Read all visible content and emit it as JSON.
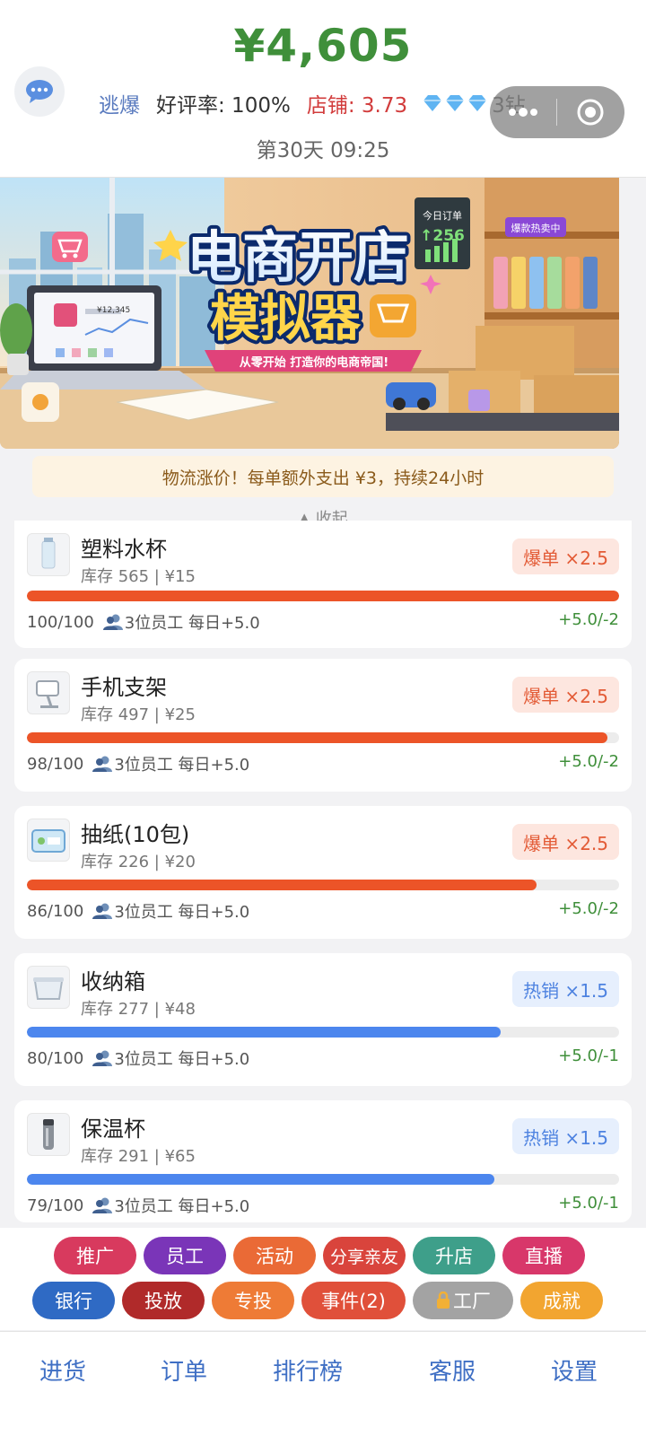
{
  "header": {
    "money": "¥4,605",
    "title_badge": "逃爆",
    "praise_rate": "好评率: 100%",
    "shop_rating": "店铺: 3.73",
    "diamonds": "3钻",
    "day_time": "第30天 09:25"
  },
  "banner": {
    "title_line1": "电商开店",
    "title_line2": "模拟器",
    "slogan": "从零开始 打造你的电商帝国!",
    "order_label": "今日订单",
    "order_value": "↑256",
    "hot_label": "爆款热卖中",
    "price_tag": "¥12,345"
  },
  "notice": "物流涨价！每单额外支出 ¥3，持续24小时",
  "collapse_label": "▲ 收起",
  "products": [
    {
      "name": "塑料水杯",
      "stock": "库存 565 | ¥15",
      "tag": "爆单 ×2.5",
      "tag_type": "hot",
      "progress": 100,
      "progress_text": "100/100",
      "staff": "3位员工 每日+5.0",
      "rate": "+5.0/-2"
    },
    {
      "name": "手机支架",
      "stock": "库存 497 | ¥25",
      "tag": "爆单 ×2.5",
      "tag_type": "hot",
      "progress": 98,
      "progress_text": "98/100",
      "staff": "3位员工 每日+5.0",
      "rate": "+5.0/-2"
    },
    {
      "name": "抽纸(10包)",
      "stock": "库存 226 | ¥20",
      "tag": "爆单 ×2.5",
      "tag_type": "hot",
      "progress": 86,
      "progress_text": "86/100",
      "staff": "3位员工 每日+5.0",
      "rate": "+5.0/-2"
    },
    {
      "name": "收纳箱",
      "stock": "库存 277 | ¥48",
      "tag": "热销 ×1.5",
      "tag_type": "warm",
      "progress": 80,
      "progress_text": "80/100",
      "staff": "3位员工 每日+5.0",
      "rate": "+5.0/-1"
    },
    {
      "name": "保温杯",
      "stock": "库存 291 | ¥65",
      "tag": "热销 ×1.5",
      "tag_type": "warm",
      "progress": 79,
      "progress_text": "79/100",
      "staff": "3位员工 每日+5.0",
      "rate": "+5.0/-1"
    }
  ],
  "actions": [
    {
      "label": "推广",
      "color": "#d83a5e"
    },
    {
      "label": "员工",
      "color": "#7a35b8"
    },
    {
      "label": "活动",
      "color": "#ea6a36"
    },
    {
      "label": "分享亲友",
      "color": "#d9443c"
    },
    {
      "label": "升店",
      "color": "#3e9f8a"
    },
    {
      "label": "直播",
      "color": "#d8376a"
    },
    {
      "label": "银行",
      "color": "#2f6ac4"
    },
    {
      "label": "投放",
      "color": "#b02a2a"
    },
    {
      "label": "专投",
      "color": "#ee7b36"
    },
    {
      "label": "事件(2)",
      "color": "#e0503a"
    },
    {
      "label": "工厂",
      "color": "#a3a3a3"
    },
    {
      "label": "成就",
      "color": "#f2a530"
    }
  ],
  "nav": [
    "进货",
    "订单",
    "排行榜",
    "客服",
    "设置"
  ]
}
